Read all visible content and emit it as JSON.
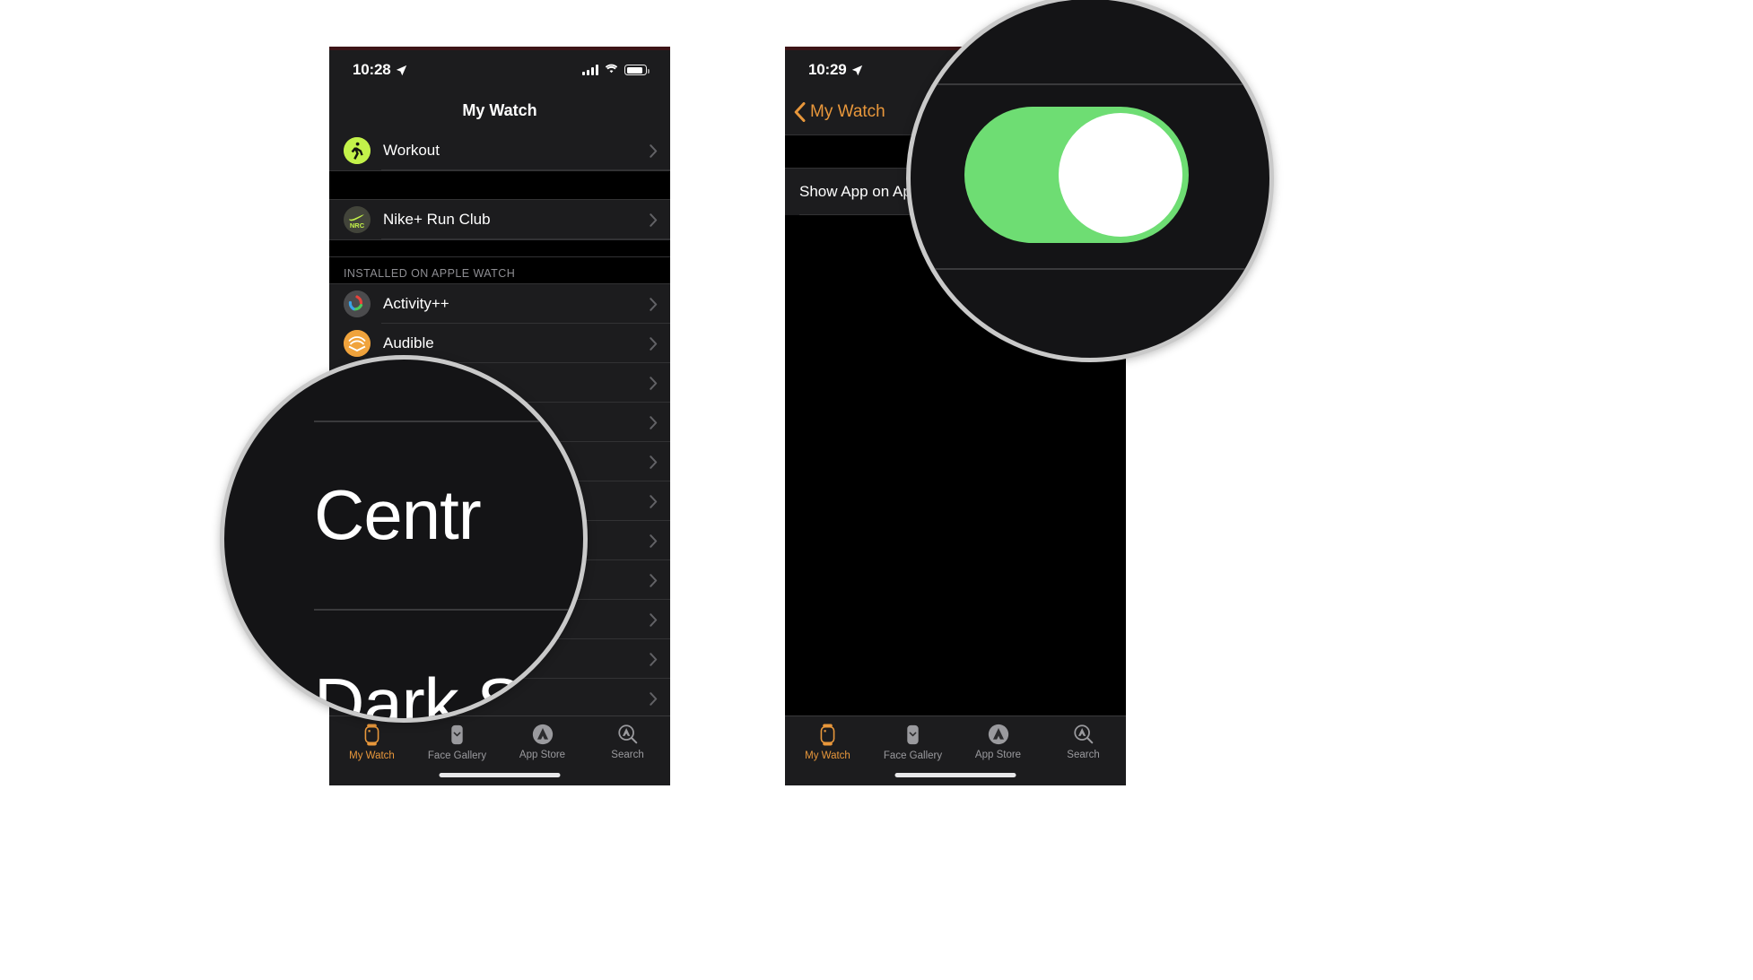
{
  "phones": [
    {
      "id": "left",
      "statusbar": {
        "time": "10:28",
        "location_icon": "location-arrow-icon",
        "signal_icon": "cellular-signal-icon",
        "wifi_icon": "wifi-icon",
        "battery_icon": "battery-icon"
      },
      "nav": {
        "title": "My Watch"
      },
      "rows": [
        {
          "label": "Workout",
          "icon": "workout-app-icon",
          "chevron": "chevron-right-icon"
        }
      ],
      "section_header": "INSTALLED ON APPLE WATCH",
      "mid_rows": [
        {
          "label": "Nike+ Run Club",
          "icon": "nike-run-club-app-icon",
          "chevron": "chevron-right-icon"
        }
      ],
      "installed_rows": [
        {
          "label": "Activity++",
          "icon": "activity-plus-app-icon",
          "chevron": "chevron-right-icon"
        },
        {
          "label": "Audible",
          "icon": "audible-app-icon",
          "chevron": "chevron-right-icon"
        }
      ],
      "hidden_rows_count": 9,
      "tabbar": [
        {
          "label": "My Watch",
          "icon": "watch-icon",
          "active": true
        },
        {
          "label": "Face Gallery",
          "icon": "watch-face-icon",
          "active": false
        },
        {
          "label": "App Store",
          "icon": "app-store-icon",
          "active": false
        },
        {
          "label": "Search",
          "icon": "search-icon",
          "active": false
        }
      ],
      "magnifier": {
        "zoomed_text_top": "Centr",
        "zoomed_text_bottom": "Dark S"
      }
    },
    {
      "id": "right",
      "statusbar": {
        "time": "10:29",
        "location_icon": "location-arrow-icon",
        "signal_icon": "cellular-signal-icon",
        "wifi_icon": "wifi-icon",
        "battery_icon": "battery-icon"
      },
      "nav": {
        "back_label": "My Watch",
        "back_icon": "chevron-left-icon"
      },
      "setting_row": {
        "label": "Show App on Ap",
        "full_label": "Show App on Apple Watch",
        "toggle_state": "on"
      },
      "tabbar": [
        {
          "label": "My Watch",
          "icon": "watch-icon",
          "active": true
        },
        {
          "label": "Face Gallery",
          "icon": "watch-face-icon",
          "active": false
        },
        {
          "label": "App Store",
          "icon": "app-store-icon",
          "active": false
        },
        {
          "label": "Search",
          "icon": "search-icon",
          "active": false
        }
      ],
      "magnifier": {
        "toggle_state": "on",
        "toggle_color": "#6edd73",
        "knob_color": "#ffffff"
      }
    }
  ],
  "colors": {
    "accent": "#e8973b",
    "toggle_on": "#6edd73",
    "list_bg": "#1c1c1e",
    "group_bg": "#000000",
    "separator": "#323234",
    "secondary_text": "#8e8e93",
    "magnifier_ring": "#c9c9c9"
  }
}
